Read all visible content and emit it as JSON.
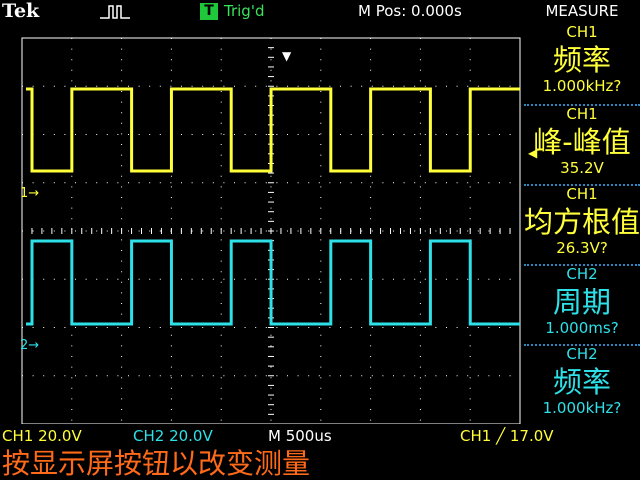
{
  "brand": "Tek",
  "top": {
    "acq_icon": "run-pulse-icon",
    "trig_badge": "T",
    "trig_status": "Trig'd",
    "m_pos": "M Pos: 0.000s"
  },
  "screen": {
    "trigger_position_icon": "down-arrow-icon",
    "ch1_marker": "1→",
    "ch2_marker": "2→",
    "trigger_level_icon": "left-arrow-icon",
    "colors": {
      "ch1": "#ffff3a",
      "ch2": "#2ee0e8",
      "grid": "#ffffff"
    },
    "ch1_wave": {
      "period_ms": 1.0,
      "duty": 0.6,
      "rise_first": true
    },
    "ch2_wave": {
      "period_ms": 1.0,
      "duty": 0.4,
      "rise_first": true
    }
  },
  "measure": {
    "title": "MEASURE",
    "items": [
      {
        "source": "CH1",
        "name": "频率",
        "value": "1.000kHz?",
        "color": "yellow"
      },
      {
        "source": "CH1",
        "name": "峰-峰值",
        "value": "35.2V",
        "color": "yellow"
      },
      {
        "source": "CH1",
        "name": "均方根值",
        "value": "26.3V?",
        "color": "yellow"
      },
      {
        "source": "CH2",
        "name": "周期",
        "value": "1.000ms?",
        "color": "cyan"
      },
      {
        "source": "CH2",
        "name": "频率",
        "value": "1.000kHz?",
        "color": "cyan"
      }
    ]
  },
  "bottom": {
    "ch1_scale": "CH1  20.0V",
    "ch2_scale": "CH2  20.0V",
    "time_scale": "M 500us",
    "trigger": "CH1 ╱ 17.0V"
  },
  "hint": "按显示屏按钮以改变测量"
}
